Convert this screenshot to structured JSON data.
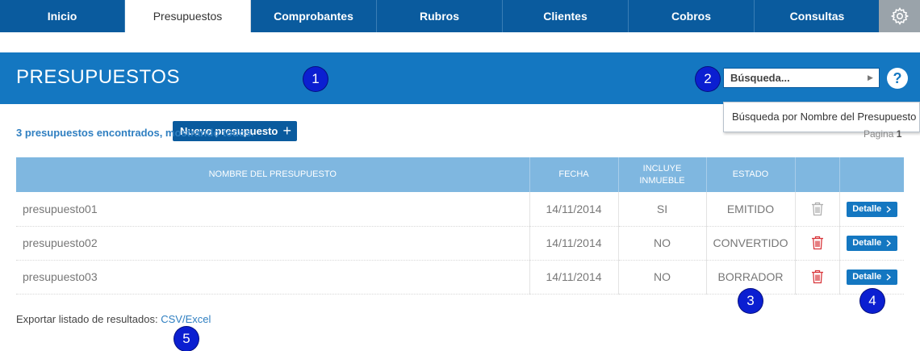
{
  "nav": {
    "tabs": [
      {
        "label": "Inicio"
      },
      {
        "label": "Presupuestos"
      },
      {
        "label": "Comprobantes"
      },
      {
        "label": "Rubros"
      },
      {
        "label": "Clientes"
      },
      {
        "label": "Cobros"
      },
      {
        "label": "Consultas"
      }
    ],
    "active_tab": "Presupuestos"
  },
  "header": {
    "title": "PRESUPUESTOS",
    "new_button_label": "Nuevo presupuesto",
    "new_button_icon": "+",
    "search_placeholder": "Búsqueda...",
    "search_tooltip": "Búsqueda por Nombre del Presupuesto",
    "help_label": "?"
  },
  "results": {
    "summary": "3 presupuestos encontrados, mostrando todos.",
    "page_label": "Pagina",
    "page_number": "1"
  },
  "table": {
    "headers": {
      "name": "NOMBRE DEL PRESUPUESTO",
      "date": "FECHA",
      "incluye_line1": "INCLUYE",
      "incluye_line2": "INMUEBLE",
      "estado": "ESTADO"
    },
    "rows": [
      {
        "name": "presupuesto01",
        "date": "14/11/2014",
        "incluye": "SI",
        "estado": "EMITIDO",
        "trash_color": "#b0b0b0",
        "detail_label": "Detalle"
      },
      {
        "name": "presupuesto02",
        "date": "14/11/2014",
        "incluye": "NO",
        "estado": "CONVERTIDO",
        "trash_color": "#d9373c",
        "detail_label": "Detalle"
      },
      {
        "name": "presupuesto03",
        "date": "14/11/2014",
        "incluye": "NO",
        "estado": "BORRADOR",
        "trash_color": "#d9373c",
        "detail_label": "Detalle"
      }
    ]
  },
  "export": {
    "label": "Exportar listado de resultados:",
    "link": "CSV/Excel"
  },
  "badges": [
    "1",
    "2",
    "3",
    "4",
    "5"
  ],
  "colors": {
    "nav_bg": "#0a5b9e",
    "band_bg": "#1477c1",
    "table_header_bg": "#7fb7e0",
    "badge_bg": "#0b1fd1",
    "trash_active": "#d9373c",
    "trash_inactive": "#b0b0b0"
  }
}
